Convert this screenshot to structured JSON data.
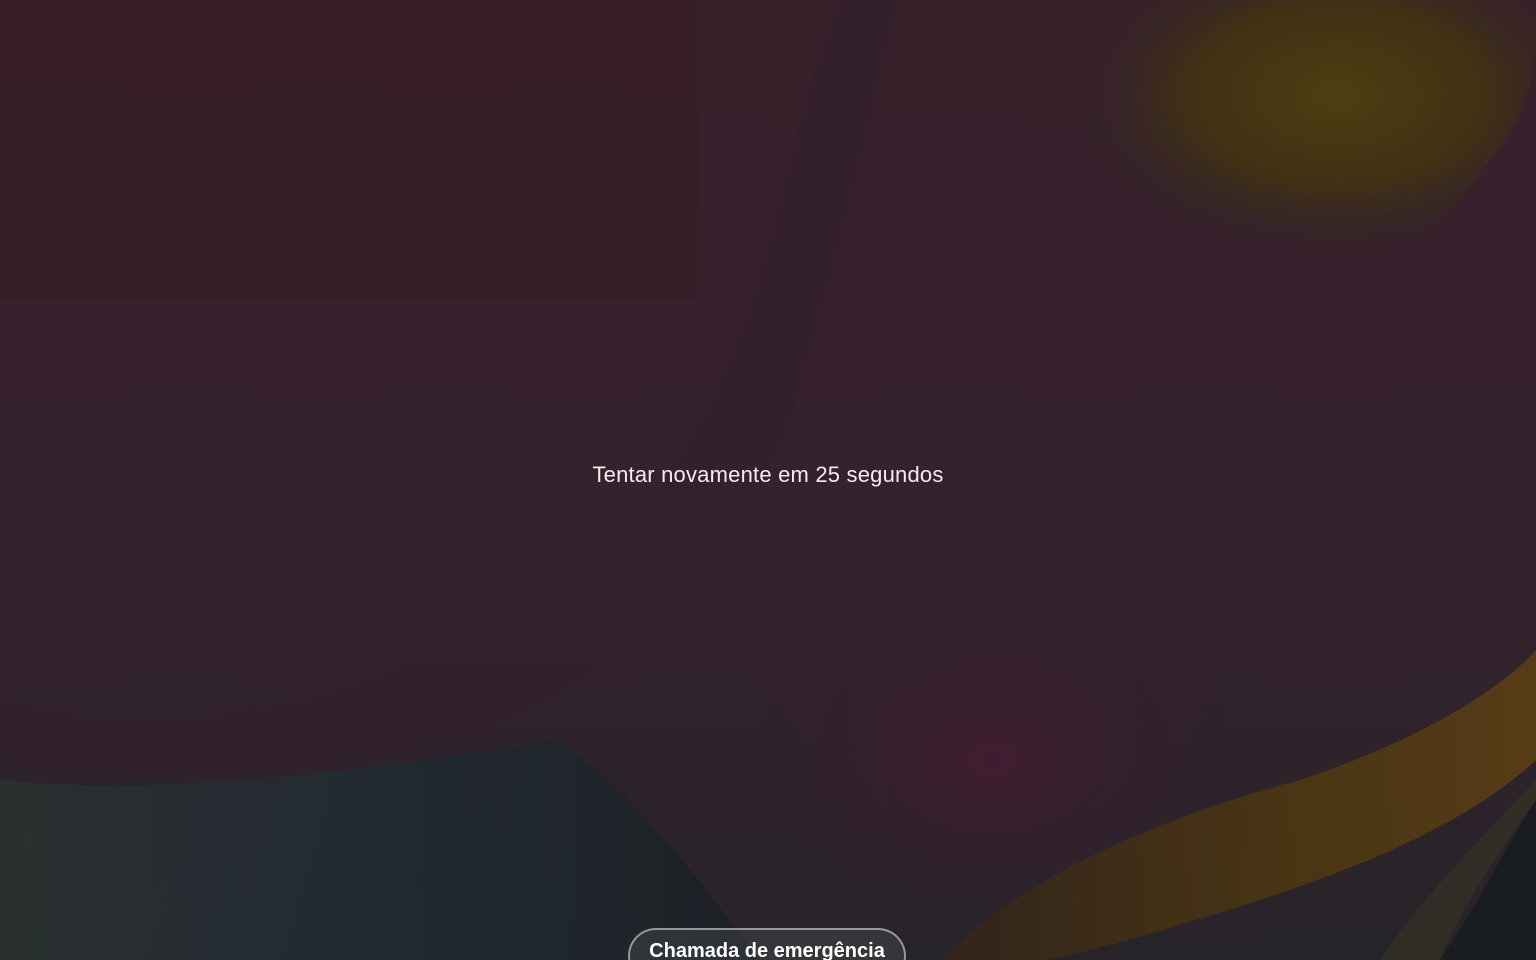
{
  "lock_screen": {
    "lockout_message": "Tentar novamente em 25 segundos",
    "emergency_call_label": "Chamada de emergência"
  },
  "colors": {
    "text": "#f2eef0",
    "button_border": "#ebe6eb"
  }
}
